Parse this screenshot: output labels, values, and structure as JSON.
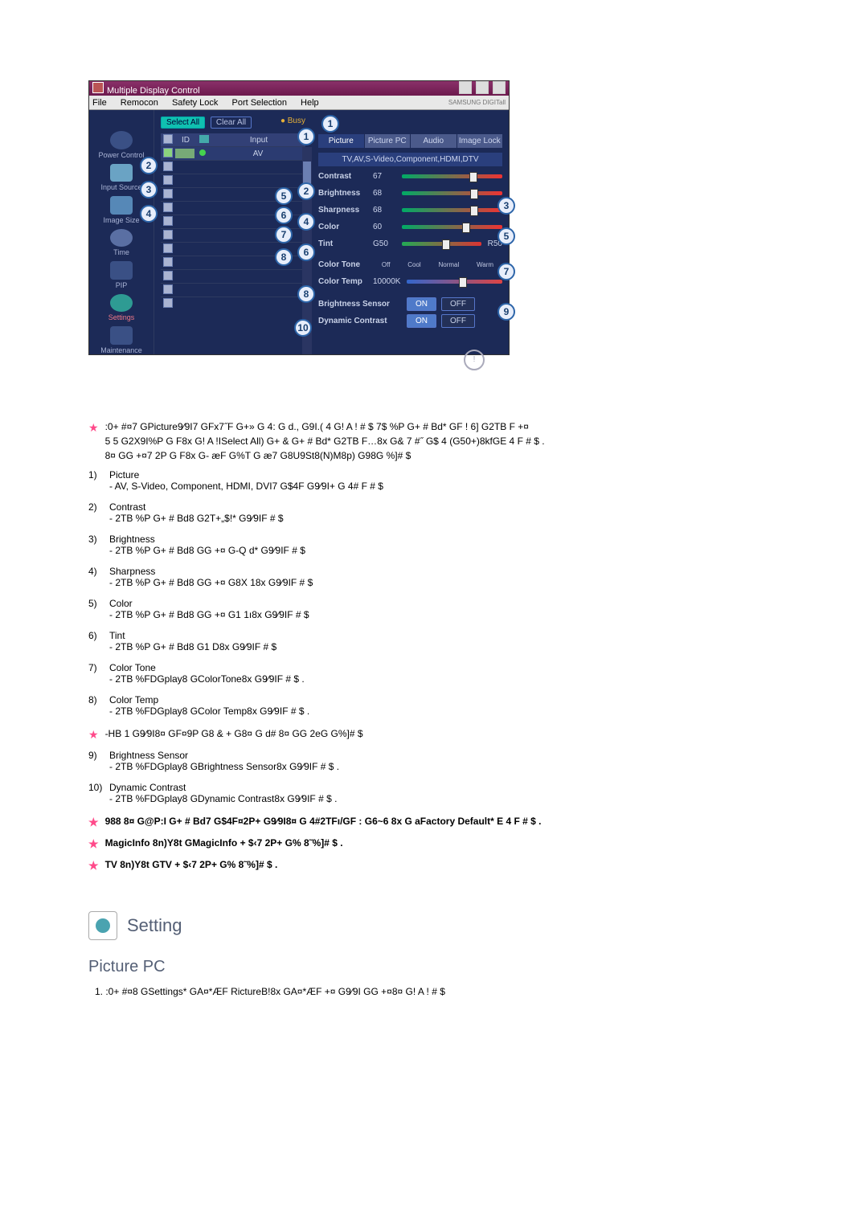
{
  "app": {
    "title": "Multiple Display Control",
    "menus": [
      "File",
      "Remocon",
      "Safety Lock",
      "Port Selection",
      "Help"
    ],
    "brand": "SAMSUNG DIGITall"
  },
  "center": {
    "selectAll": "Select All",
    "clearAll": "Clear All",
    "busy": "Busy",
    "head": {
      "id": "ID",
      "input": "Input"
    },
    "rows": [
      {
        "checked": true,
        "input": "AV",
        "statusColor": "#45d24e"
      },
      {
        "checked": false,
        "input": ""
      },
      {
        "checked": false,
        "input": ""
      },
      {
        "checked": false,
        "input": ""
      },
      {
        "checked": false,
        "input": ""
      },
      {
        "checked": false,
        "input": ""
      },
      {
        "checked": false,
        "input": ""
      },
      {
        "checked": false,
        "input": ""
      },
      {
        "checked": false,
        "input": ""
      },
      {
        "checked": false,
        "input": ""
      },
      {
        "checked": false,
        "input": ""
      },
      {
        "checked": false,
        "input": ""
      }
    ]
  },
  "sidebar": {
    "items": [
      "Power Control",
      "Input Source",
      "Image Size",
      "Time",
      "PIP",
      "Settings",
      "Maintenance"
    ]
  },
  "right": {
    "tabs": [
      "Picture",
      "Picture PC",
      "Audio",
      "Image Lock"
    ],
    "subheader": "TV,AV,S-Video,Component,HDMI,DTV",
    "rows": {
      "contrast": {
        "label": "Contrast",
        "val": "67"
      },
      "brightness": {
        "label": "Brightness",
        "val": "68"
      },
      "sharpness": {
        "label": "Sharpness",
        "val": "68"
      },
      "color": {
        "label": "Color",
        "val": "60"
      },
      "tint": {
        "label": "Tint",
        "valL": "G50",
        "valR": "R50"
      }
    },
    "colorTone": {
      "label": "Color Tone",
      "opts": [
        "Off",
        "Cool",
        "Normal",
        "Warm"
      ]
    },
    "colorTemp": {
      "label": "Color Temp",
      "val": "10000K"
    },
    "brightSensor": {
      "label": "Brightness Sensor",
      "on": "ON",
      "off": "OFF"
    },
    "dynamic": {
      "label": "Dynamic Contrast",
      "on": "ON",
      "off": "OFF"
    }
  },
  "callouts": {
    "top": "1",
    "sideNums": [
      "2",
      "3",
      "4"
    ],
    "midNums": [
      "5",
      "6",
      "7",
      "8"
    ],
    "rightNums": {
      "r1": "1",
      "r2": "2",
      "r3": "3",
      "r4": "4",
      "r5": "5",
      "r6": "6",
      "r7": "7",
      "r8": "8",
      "r9": "9",
      "r10": "10"
    }
  },
  "text": {
    "star1_l1": ":0+ #¤7 GPicture9⁄9I7 GFx7˝F G+» G 4: G d., G9I.( 4 G! A ! # $ 7$ %P G+ # Bd* GF ! 6] G2TB F +¤",
    "star1_l2": "5 5 G2X9I%P G F8x G! A !ISelect All) G+ & G+ # Bd* G2TB F…8x G& 7 #˝ G$ 4 (G50+)8kfGE 4 F # $ .",
    "star1_l3": "8¤ GG +¤7 2P G F8x G- æF    G%T G æ7 G8U9St8(N)M8p) G98G %]# $",
    "li": [
      {
        "h": "1)",
        "t": "Picture",
        "sub": "- AV, S-Video, Component, HDMI, DVI7  G$4F G9⁄9I+ G 4# F # $"
      },
      {
        "h": "2)",
        "t": "Contrast",
        "sub": "- 2TB %P G+ # Bd8 G2T+„$!* G9⁄9IF # $"
      },
      {
        "h": "3)",
        "t": "Brightness",
        "sub": "- 2TB %P G+ # Bd8 GG +¤ G-Q d* G9⁄9IF # $"
      },
      {
        "h": "4)",
        "t": "Sharpness",
        "sub": "- 2TB %P G+ # Bd8 GG +¤ G8X 18x G9⁄9IF # $"
      },
      {
        "h": "5)",
        "t": "Color",
        "sub": "- 2TB %P G+ # Bd8 GG +¤ G1 1ı8x G9⁄9IF # $"
      },
      {
        "h": "6)",
        "t": "Tint",
        "sub": "- 2TB %P G+ # Bd8 G1  D8x G9⁄9IF # $"
      },
      {
        "h": "7)",
        "t": "Color Tone",
        "sub": "- 2TB %FDGplay8 GColorTone8x G9⁄9IF # $ ."
      },
      {
        "h": "8)",
        "t": "Color Temp",
        "sub": "- 2TB %FDGplay8 GColor Temp8x G9⁄9IF # $ ."
      }
    ],
    "star_mid": "-HB 1 G9⁄9I8¤ GF¤9P G8 & + G8¤ G d# 8¤ GG 2eG G%]# $",
    "li2": [
      {
        "h": "9)",
        "t": "Brightness Sensor",
        "sub": "- 2TB %FDGplay8 GBrightness Sensor8x G9⁄9IF # $ ."
      },
      {
        "h": "10)",
        "t": "Dynamic Contrast",
        "sub": "- 2TB %FDGplay8 GDynamic Contrast8x G9⁄9IF # $ ."
      }
    ],
    "star2": "988 8¤ G@P:I G+ # Bd7 G$4F¤2P+ G9⁄9I8¤ G 4#2TFı/GF : G6~6 8x G aFactory Default*    E 4 F # $    .",
    "star3": "MagicInfo 8n)Y8t GMagicInfo + $‹7 2P+ G% 8˜%]# $ .",
    "star4": "TV 8n)Y8t GTV + $‹7 2P+ G% 8˜%]# $ .",
    "sectionTitle": "Setting",
    "subTitle": "Picture PC",
    "para1": "1.   :0+ #¤8 GSettings* GA¤*ÆF    RictureB!8x GA¤*ÆF +¤ G9⁄9I GG +¤8¤ G! A ! # $"
  }
}
